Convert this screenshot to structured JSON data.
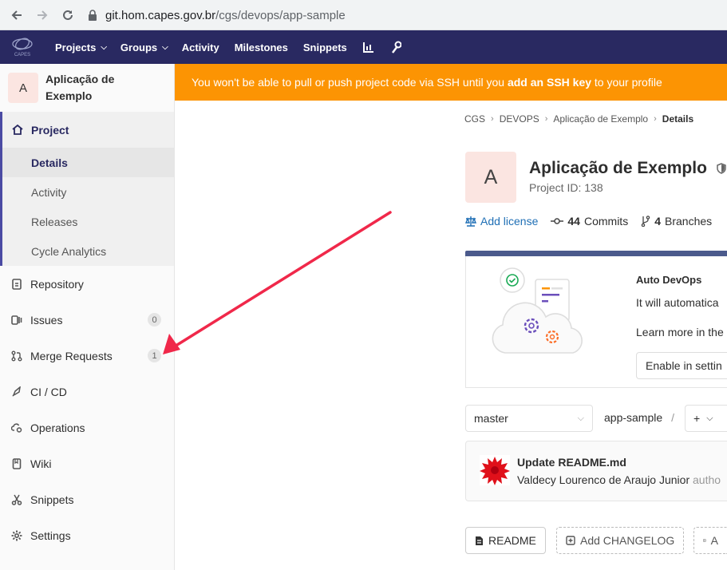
{
  "browser": {
    "url_host": "git.hom.capes.gov.br",
    "url_path": "/cgs/devops/app-sample"
  },
  "topnav": {
    "logo_text": "CAPES",
    "items": [
      {
        "label": "Projects",
        "dropdown": true
      },
      {
        "label": "Groups",
        "dropdown": true
      },
      {
        "label": "Activity",
        "dropdown": false
      },
      {
        "label": "Milestones",
        "dropdown": false
      },
      {
        "label": "Snippets",
        "dropdown": false
      }
    ],
    "icons": [
      "chart-icon",
      "wrench-icon"
    ],
    "bg_color": "#292961"
  },
  "sidebar": {
    "avatar_letter": "A",
    "project_name_line1": "Aplicação de",
    "project_name_line2": "Exemplo",
    "project_section": {
      "label": "Project",
      "subitems": [
        "Details",
        "Activity",
        "Releases",
        "Cycle Analytics"
      ]
    },
    "items": [
      {
        "label": "Repository",
        "icon": "document-icon",
        "badge": null
      },
      {
        "label": "Issues",
        "icon": "issues-icon",
        "badge": "0"
      },
      {
        "label": "Merge Requests",
        "icon": "merge-request-icon",
        "badge": "1"
      },
      {
        "label": "CI / CD",
        "icon": "rocket-icon",
        "badge": null
      },
      {
        "label": "Operations",
        "icon": "cloud-gear-icon",
        "badge": null
      },
      {
        "label": "Wiki",
        "icon": "book-icon",
        "badge": null
      },
      {
        "label": "Snippets",
        "icon": "scissors-icon",
        "badge": null
      },
      {
        "label": "Settings",
        "icon": "gear-icon",
        "badge": null
      }
    ]
  },
  "banner": {
    "text_before": "You won't be able to pull or push project code via SSH until you ",
    "link_text": "add an SSH key",
    "text_after": " to your profile",
    "color": "#fc9403"
  },
  "breadcrumb": [
    "CGS",
    "DEVOPS",
    "Aplicação de Exemplo",
    "Details"
  ],
  "project": {
    "avatar_letter": "A",
    "title": "Aplicação de Exemplo",
    "project_id": "Project ID: 138"
  },
  "stats": {
    "add_license": "Add license",
    "commits_count": "44",
    "commits_label": "Commits",
    "branches_count": "4",
    "branches_label": "Branches"
  },
  "devops": {
    "title": "Auto DevOps",
    "text1": "It will automatica",
    "text2": "Learn more in the",
    "button": "Enable in settin"
  },
  "repo": {
    "branch": "master",
    "path": "app-sample",
    "separator": "/",
    "add_label": "+"
  },
  "commit": {
    "title": "Update README.md",
    "author": "Valdecy Lourenco de Araujo Junior",
    "suffix": "autho"
  },
  "file_buttons": [
    {
      "label": "README",
      "style": "solid",
      "icon": "file-icon"
    },
    {
      "label": "Add CHANGELOG",
      "style": "dashed",
      "icon": "plus-square-icon"
    },
    {
      "label": "A",
      "style": "dashed",
      "icon": "plus-square-icon"
    }
  ],
  "annotation_arrow_color": "#f0284a"
}
